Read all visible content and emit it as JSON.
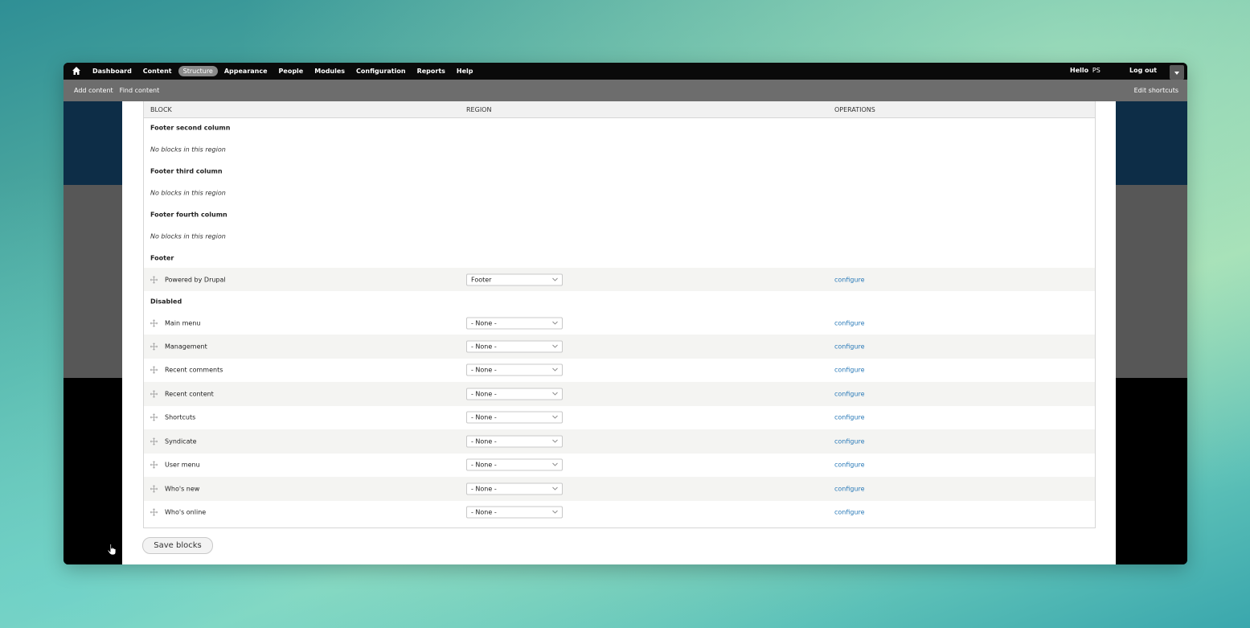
{
  "toolbar": {
    "nav": [
      "Dashboard",
      "Content",
      "Structure",
      "Appearance",
      "People",
      "Modules",
      "Configuration",
      "Reports",
      "Help"
    ],
    "active": "Structure",
    "hello": "Hello",
    "user": "PS",
    "logout": "Log out"
  },
  "shortcuts": {
    "add_content": "Add content",
    "find_content": "Find content",
    "edit": "Edit shortcuts"
  },
  "table": {
    "headers": {
      "block": "BLOCK",
      "region": "REGION",
      "operations": "OPERATIONS"
    },
    "rows": [
      {
        "type": "region",
        "label": "Footer second column"
      },
      {
        "type": "empty",
        "label": "No blocks in this region"
      },
      {
        "type": "region",
        "label": "Footer third column"
      },
      {
        "type": "empty",
        "label": "No blocks in this region"
      },
      {
        "type": "region",
        "label": "Footer fourth column"
      },
      {
        "type": "empty",
        "label": "No blocks in this region"
      },
      {
        "type": "region",
        "label": "Footer"
      },
      {
        "type": "block",
        "label": "Powered by Drupal",
        "region": "Footer",
        "op": "configure"
      },
      {
        "type": "region",
        "label": "Disabled"
      },
      {
        "type": "block",
        "label": "Main menu",
        "region": "- None -",
        "op": "configure"
      },
      {
        "type": "block",
        "label": "Management",
        "region": "- None -",
        "op": "configure"
      },
      {
        "type": "block",
        "label": "Recent comments",
        "region": "- None -",
        "op": "configure"
      },
      {
        "type": "block",
        "label": "Recent content",
        "region": "- None -",
        "op": "configure"
      },
      {
        "type": "block",
        "label": "Shortcuts",
        "region": "- None -",
        "op": "configure"
      },
      {
        "type": "block",
        "label": "Syndicate",
        "region": "- None -",
        "op": "configure"
      },
      {
        "type": "block",
        "label": "User menu",
        "region": "- None -",
        "op": "configure"
      },
      {
        "type": "block",
        "label": "Who's new",
        "region": "- None -",
        "op": "configure"
      },
      {
        "type": "block",
        "label": "Who's online",
        "region": "- None -",
        "op": "configure"
      }
    ]
  },
  "save_label": "Save blocks",
  "icons": {
    "home": "home-icon",
    "drag": "drag-handle-icon",
    "chevron": "chevron-down-icon",
    "cursor": "hand-cursor-icon"
  },
  "colors": {
    "link": "#2a7ab8",
    "toolbar": "#0a0a0a",
    "shortcuts_bar": "#6d6d6d"
  }
}
